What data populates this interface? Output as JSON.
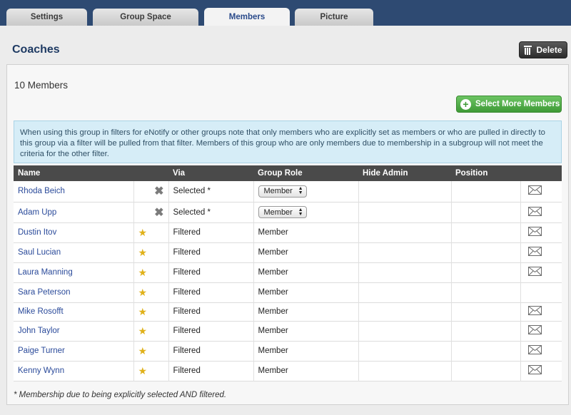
{
  "tabs": [
    "Settings",
    "Group Space",
    "Members",
    "Picture"
  ],
  "active_tab": "Members",
  "page_title": "Coaches",
  "delete_label": "Delete",
  "members_count": "10 Members",
  "select_more_label": "Select More Members",
  "notice": "When using this group in filters for eNotify or other groups note that only members who are explicitly set as members or who are pulled in directly to this group via a filter will be pulled from that filter. Members of this group who are only members due to membership in a subgroup will not meet the criteria for the other filter.",
  "columns": [
    "Name",
    "Via",
    "Group Role",
    "Hide Admin",
    "Position"
  ],
  "rows": [
    {
      "name": "Rhoda Beich",
      "marker": "x",
      "via": "Selected *",
      "role": "Member",
      "role_dropdown": true,
      "email": true
    },
    {
      "name": "Adam Upp",
      "marker": "x",
      "via": "Selected *",
      "role": "Member",
      "role_dropdown": true,
      "email": true
    },
    {
      "name": "Dustin Itov",
      "marker": "star",
      "via": "Filtered",
      "role": "Member",
      "role_dropdown": false,
      "email": true
    },
    {
      "name": "Saul Lucian",
      "marker": "star",
      "via": "Filtered",
      "role": "Member",
      "role_dropdown": false,
      "email": true
    },
    {
      "name": "Laura Manning",
      "marker": "star",
      "via": "Filtered",
      "role": "Member",
      "role_dropdown": false,
      "email": true
    },
    {
      "name": "Sara Peterson",
      "marker": "star",
      "via": "Filtered",
      "role": "Member",
      "role_dropdown": false,
      "email": false
    },
    {
      "name": "Mike Rosofft",
      "marker": "star",
      "via": "Filtered",
      "role": "Member",
      "role_dropdown": false,
      "email": true
    },
    {
      "name": "John Taylor",
      "marker": "star",
      "via": "Filtered",
      "role": "Member",
      "role_dropdown": false,
      "email": true
    },
    {
      "name": "Paige Turner",
      "marker": "star",
      "via": "Filtered",
      "role": "Member",
      "role_dropdown": false,
      "email": true
    },
    {
      "name": "Kenny Wynn",
      "marker": "star",
      "via": "Filtered",
      "role": "Member",
      "role_dropdown": false,
      "email": true
    }
  ],
  "footnote": "* Membership due to being explicitly selected AND filtered.",
  "colors": {
    "header_bar": "#2e4a72",
    "link": "#2a4a9a",
    "green": "#4caa42",
    "notice_bg": "#d6edf7"
  }
}
